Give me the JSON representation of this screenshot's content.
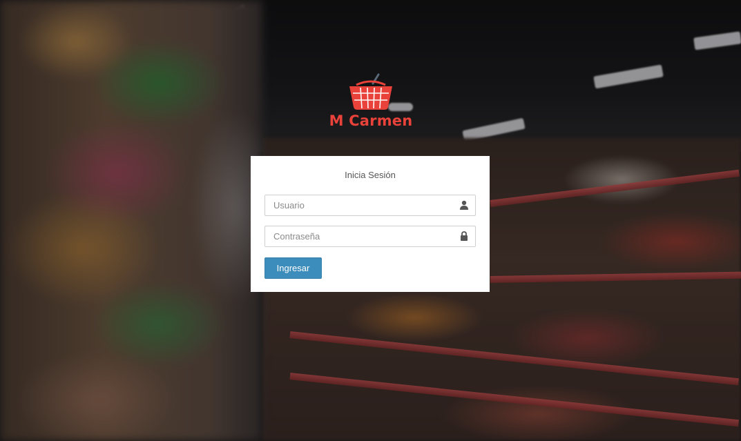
{
  "brand": {
    "name": "M Carmen",
    "logo_icon": "shopping-basket-icon",
    "color": "#e8423a"
  },
  "login": {
    "title": "Inicia Sesión",
    "username": {
      "placeholder": "Usuario",
      "value": "",
      "icon": "user-icon"
    },
    "password": {
      "placeholder": "Contraseña",
      "value": "",
      "icon": "lock-icon"
    },
    "submit_label": "Ingresar",
    "submit_color": "#3c8dbc"
  }
}
